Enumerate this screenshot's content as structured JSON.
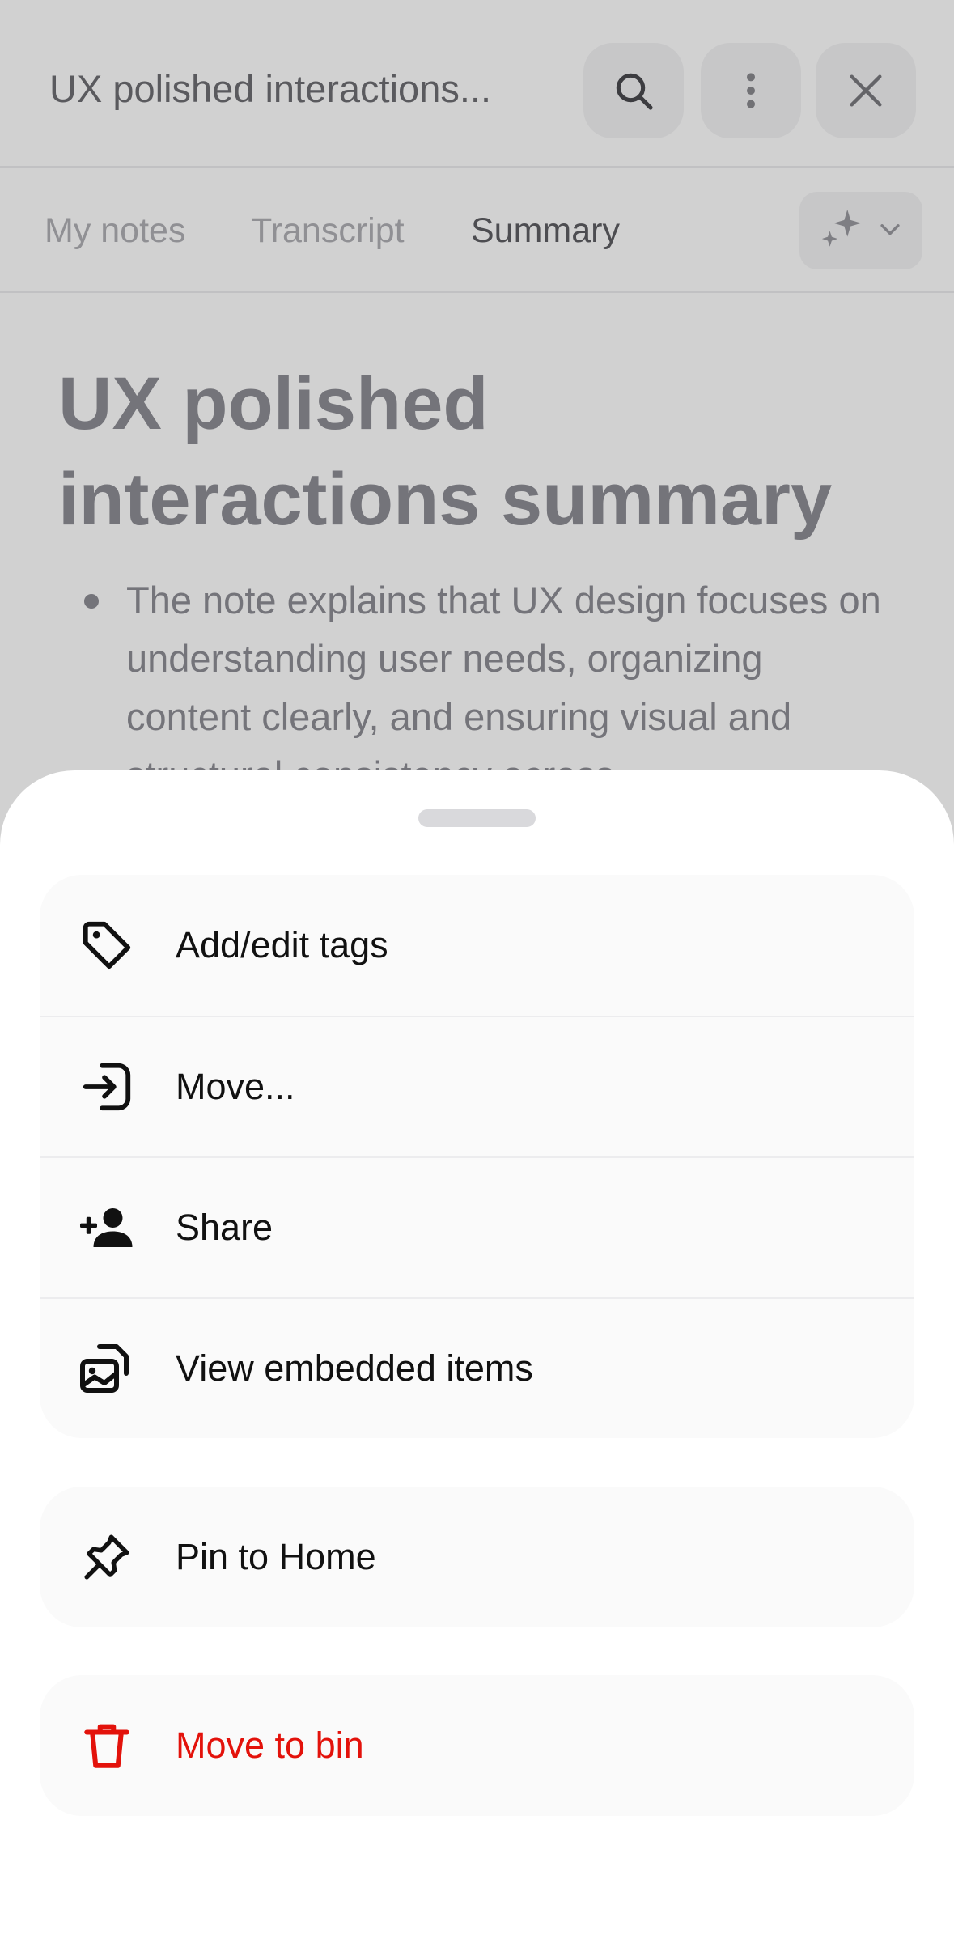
{
  "header": {
    "title": "UX polished interactions...",
    "search_icon": "search-icon",
    "more_icon": "more-vertical-icon",
    "close_icon": "close-icon"
  },
  "tabs": [
    {
      "label": "My notes",
      "active": false
    },
    {
      "label": "Transcript",
      "active": false
    },
    {
      "label": "Summary",
      "active": true
    }
  ],
  "ai_menu": {
    "icon": "sparkles-icon",
    "chevron": "chevron-down-icon"
  },
  "note": {
    "title": "UX polished interactions summary",
    "bullet": "The note explains that UX design focuses on understanding user needs, organizing content clearly, and ensuring visual and structural consistency across"
  },
  "sheet": {
    "groups": [
      {
        "items": [
          {
            "label": "Add/edit tags",
            "icon": "tag-icon"
          },
          {
            "label": "Move...",
            "icon": "move-icon"
          },
          {
            "label": "Share",
            "icon": "add-person-icon"
          },
          {
            "label": "View embedded items",
            "icon": "embedded-items-icon"
          }
        ]
      },
      {
        "items": [
          {
            "label": "Pin to Home",
            "icon": "pin-icon"
          }
        ]
      },
      {
        "items": [
          {
            "label": "Move to bin",
            "icon": "trash-icon",
            "color": "#e3120b"
          }
        ]
      }
    ]
  },
  "colors": {
    "danger": "#e3120b",
    "text": "#111111",
    "muted": "#8e8e95"
  }
}
